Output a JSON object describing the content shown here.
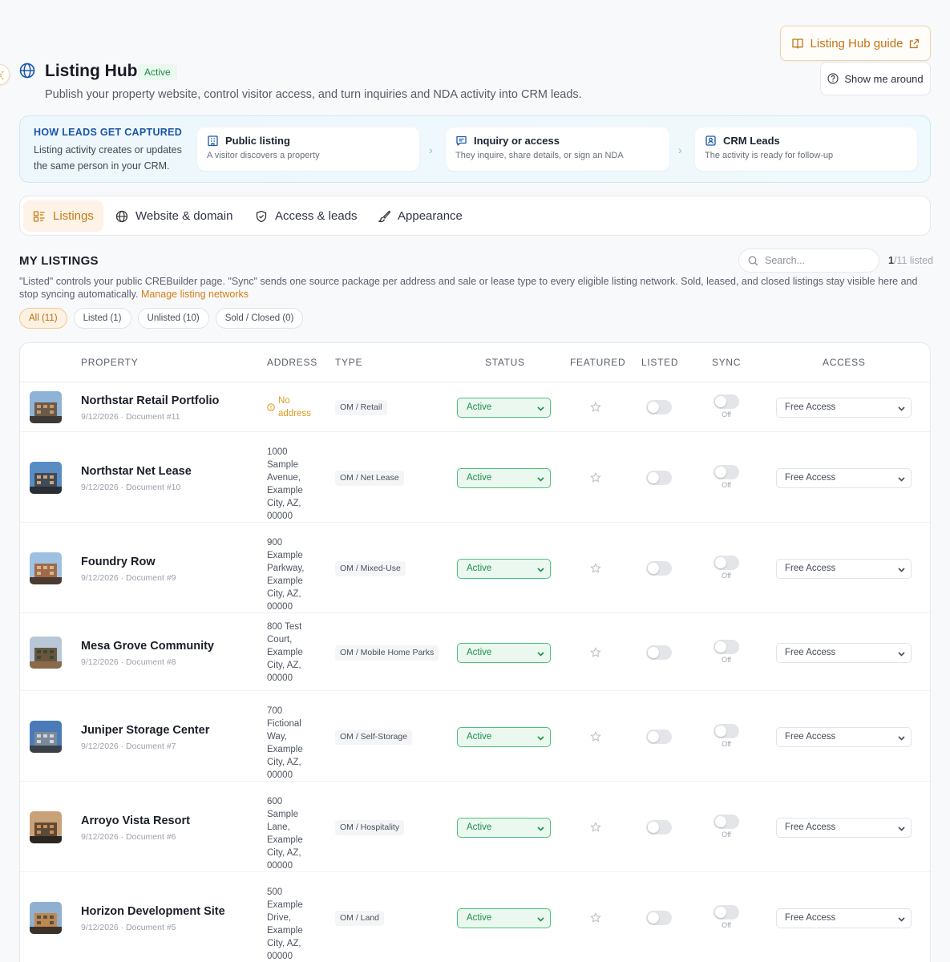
{
  "header": {
    "title": "Listing Hub",
    "badge": "Active",
    "subtitle": "Publish your property website, control visitor access, and turn inquiries and NDA activity into CRM leads.",
    "guide_label": "Listing Hub guide",
    "tour_label": "Show me around",
    "icon": "globe-icon"
  },
  "flow": {
    "heading": "HOW LEADS GET CAPTURED",
    "text": "Listing activity creates or updates the same person in your CRM.",
    "steps": [
      {
        "title": "Public listing",
        "desc": "A visitor discovers a property",
        "icon": "building-icon"
      },
      {
        "title": "Inquiry or access",
        "desc": "They inquire, share details, or sign an NDA",
        "icon": "message-icon"
      },
      {
        "title": "CRM Leads",
        "desc": "The activity is ready for follow-up",
        "icon": "contact-icon"
      }
    ]
  },
  "tabs": [
    {
      "label": "Listings",
      "icon": "listings-icon",
      "active": true
    },
    {
      "label": "Website & domain",
      "icon": "globe-icon"
    },
    {
      "label": "Access & leads",
      "icon": "shield-icon"
    },
    {
      "label": "Appearance",
      "icon": "brush-icon"
    }
  ],
  "listings": {
    "title": "MY LISTINGS",
    "search_placeholder": "Search...",
    "count_listed": "1",
    "count_total": "/11 listed",
    "description": "\"Listed\" controls your public CREBuilder page. \"Sync\" sends one source package per address and sale or lease type to every eligible listing network. Sold, leased, and closed listings stay visible here and stop syncing automatically.",
    "networks_link": "Manage listing networks",
    "filters": [
      {
        "label": "All (11)",
        "active": true
      },
      {
        "label": "Listed (1)"
      },
      {
        "label": "Unlisted (10)"
      },
      {
        "label": "Sold / Closed (0)"
      }
    ]
  },
  "table": {
    "columns": {
      "property": "PROPERTY",
      "address": "ADDRESS",
      "type": "TYPE",
      "status": "STATUS",
      "featured": "FEATURED",
      "listed": "LISTED",
      "sync": "SYNC",
      "access": "ACCESS"
    },
    "rows": [
      {
        "name": "Northstar Retail Portfolio",
        "meta": "9/12/2026 · Document #11",
        "address": "",
        "no_address": "No address",
        "type": "OM / Retail",
        "status": "Active",
        "featured": false,
        "listed": false,
        "sync": "Off",
        "access": "Free Access"
      },
      {
        "name": "Northstar Net Lease",
        "meta": "9/12/2026 · Document #10",
        "address": "1000 Sample Avenue, Example City, AZ, 00000",
        "type": "OM / Net Lease",
        "status": "Active",
        "featured": false,
        "listed": false,
        "sync": "Off",
        "access": "Free Access"
      },
      {
        "name": "Foundry Row",
        "meta": "9/12/2026 · Document #9",
        "address": "900 Example Parkway, Example City, AZ, 00000",
        "type": "OM / Mixed-Use",
        "status": "Active",
        "featured": false,
        "listed": false,
        "sync": "Off",
        "access": "Free Access"
      },
      {
        "name": "Mesa Grove Community",
        "meta": "9/12/2026 · Document #8",
        "address": "800 Test Court, Example City, AZ, 00000",
        "type": "OM / Mobile Home Parks",
        "status": "Active",
        "featured": false,
        "listed": false,
        "sync": "Off",
        "access": "Free Access"
      },
      {
        "name": "Juniper Storage Center",
        "meta": "9/12/2026 · Document #7",
        "address": "700 Fictional Way, Example City, AZ, 00000",
        "type": "OM / Self-Storage",
        "status": "Active",
        "featured": false,
        "listed": false,
        "sync": "Off",
        "access": "Free Access"
      },
      {
        "name": "Arroyo Vista Resort",
        "meta": "9/12/2026 · Document #6",
        "address": "600 Sample Lane, Example City, AZ, 00000",
        "type": "OM / Hospitality",
        "status": "Active",
        "featured": false,
        "listed": false,
        "sync": "Off",
        "access": "Free Access"
      },
      {
        "name": "Horizon Development Site",
        "meta": "9/12/2026 · Document #5",
        "address": "500 Example Drive, Example City, AZ, 00000",
        "type": "OM / Land",
        "status": "Active",
        "featured": false,
        "listed": false,
        "sync": "Off",
        "access": "Free Access"
      }
    ]
  },
  "colors": {
    "accent": "#c57a16",
    "status_green": "#1e8d4c",
    "link_blue": "#1a55a8"
  }
}
